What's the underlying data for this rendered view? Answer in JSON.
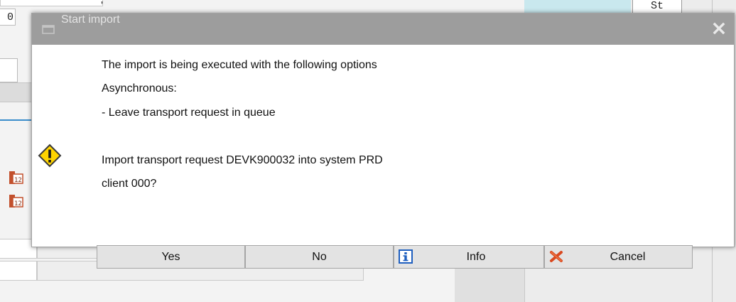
{
  "background": {
    "top_field_value": "0",
    "header_fragment": "'",
    "column_header": "St"
  },
  "dialog": {
    "title": "Start import",
    "close_glyph": "✕",
    "lines": [
      "The import is being executed with the following options",
      "Asynchronous:",
      "- Leave transport request in queue",
      "Import transport request DEVK900032 into system PRD",
      "client 000?"
    ],
    "buttons": {
      "yes": "Yes",
      "no": "No",
      "info": "Info",
      "cancel": "Cancel"
    },
    "icons": {
      "title": "window-icon",
      "message": "warning-icon",
      "info": "info-icon",
      "cancel": "cancel-x-icon"
    }
  },
  "colors": {
    "titlebar": "#9d9d9d",
    "button_face": "#e3e3e3",
    "warning_yellow": "#ffd400",
    "info_blue": "#1f5fbf",
    "cancel_red": "#d9481f",
    "accent_blue": "#3a8dcb"
  }
}
